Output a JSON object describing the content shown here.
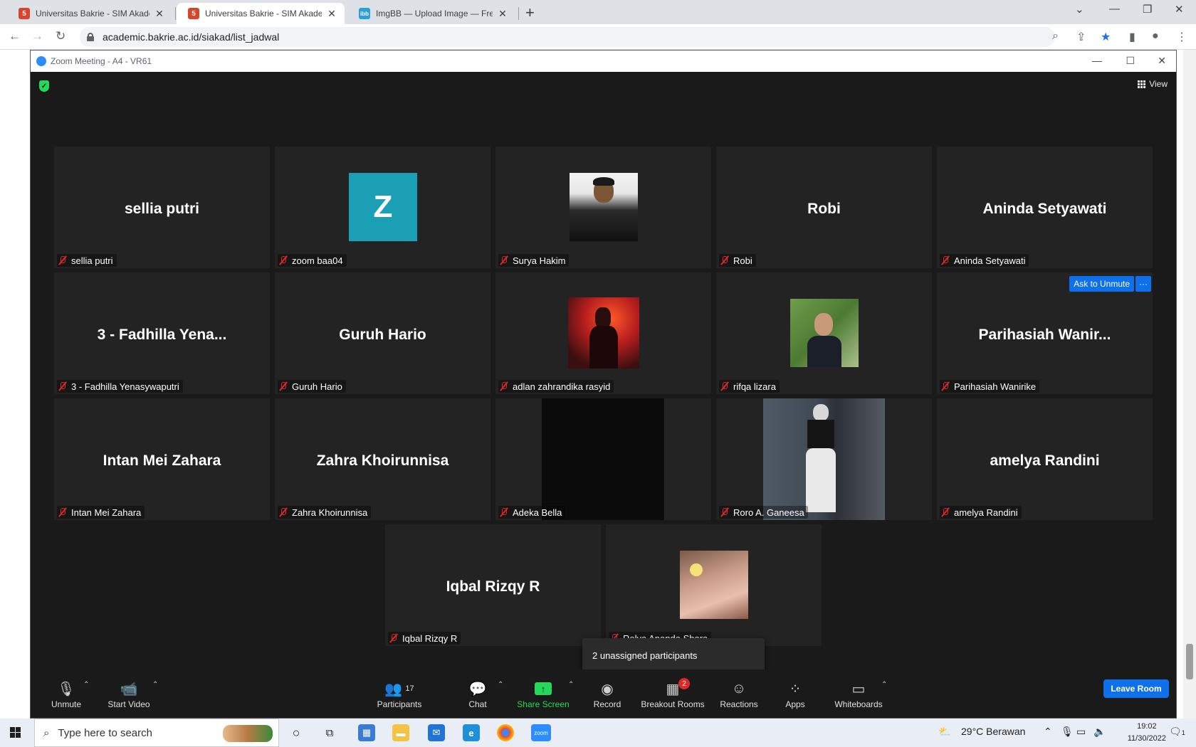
{
  "browser": {
    "tabs": [
      {
        "title": "Universitas Bakrie - SIM Akademik",
        "favicon": "html5-shield-icon",
        "active": false
      },
      {
        "title": "Universitas Bakrie - SIM Akademik",
        "favicon": "html5-shield-icon",
        "active": true
      },
      {
        "title": "ImgBB — Upload Image — Free Image Hosting",
        "favicon": "imgbb-icon",
        "active": false
      }
    ],
    "favicon_labels": {
      "bakrie": "5",
      "imgbb": "ibb"
    },
    "url": "academic.bakrie.ac.id/siakad/list_jadwal"
  },
  "zoom": {
    "window_title": "Zoom Meeting - A4 - VR61",
    "view_label": "View",
    "ask_to_unmute": "Ask to Unmute",
    "more_label": "···",
    "tooltip": "2 unassigned participants",
    "participants": [
      {
        "display": "sellia putri",
        "label": "sellia putri"
      },
      {
        "display": "Z",
        "label": "zoom baa04"
      },
      {
        "display": "",
        "label": "Surya Hakim"
      },
      {
        "display": "Robi",
        "label": "Robi"
      },
      {
        "display": "Aninda Setyawati",
        "label": "Aninda Setyawati"
      },
      {
        "display": "3 - Fadhilla Yena...",
        "label": "3 - Fadhilla Yenasywaputri"
      },
      {
        "display": "Guruh Hario",
        "label": "Guruh Hario"
      },
      {
        "display": "",
        "label": "adlan zahrandika rasyid"
      },
      {
        "display": "",
        "label": "rifqa lizara"
      },
      {
        "display": "Parihasiah  Wanir...",
        "label": "Parihasiah Wanirike"
      },
      {
        "display": "Intan Mei Zahara",
        "label": "Intan Mei Zahara"
      },
      {
        "display": "Zahra Khoirunnisa",
        "label": "Zahra Khoirunnisa"
      },
      {
        "display": "",
        "label": "Adeka Bella"
      },
      {
        "display": "",
        "label": "Roro A. Ganeesa"
      },
      {
        "display": "amelya Randini",
        "label": "amelya Randini"
      },
      {
        "display": "Iqbal Rizqy R",
        "label": "Iqbal Rizqy R"
      },
      {
        "display": "",
        "label": "Relya Ananda Shara"
      }
    ],
    "toolbar": {
      "unmute": "Unmute",
      "start_video": "Start Video",
      "participants": "Participants",
      "participants_count": "17",
      "chat": "Chat",
      "share_screen": "Share Screen",
      "record": "Record",
      "breakout_rooms": "Breakout Rooms",
      "breakout_badge": "2",
      "reactions": "Reactions",
      "apps": "Apps",
      "whiteboards": "Whiteboards",
      "leave_room": "Leave Room"
    }
  },
  "taskbar": {
    "search_placeholder": "Type here to search",
    "weather": "29°C  Berawan",
    "time": "19:02",
    "date": "11/30/2022",
    "notification_count": "1",
    "zoom_label": "zoom"
  },
  "colors": {
    "zoom_bg": "#1a1a1a",
    "tile_bg": "#232323",
    "zoom_blue": "#0e71eb",
    "share_green": "#23d959",
    "muted_red": "#e02828"
  }
}
